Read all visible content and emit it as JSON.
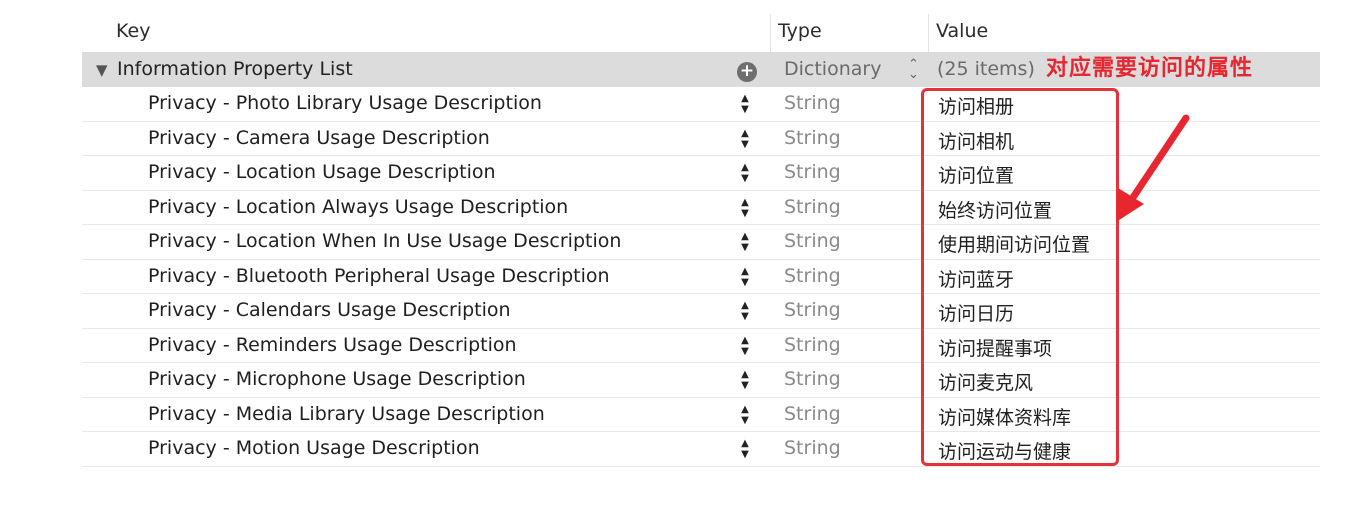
{
  "columns": {
    "key": "Key",
    "type": "Type",
    "value": "Value"
  },
  "root": {
    "key": "Information Property List",
    "type": "Dictionary",
    "value": "(25 items)"
  },
  "rows": [
    {
      "key": "Privacy - Photo Library Usage Description",
      "type": "String",
      "value": "访问相册"
    },
    {
      "key": "Privacy - Camera Usage Description",
      "type": "String",
      "value": "访问相机"
    },
    {
      "key": "Privacy - Location Usage Description",
      "type": "String",
      "value": "访问位置"
    },
    {
      "key": "Privacy - Location Always Usage Description",
      "type": "String",
      "value": "始终访问位置"
    },
    {
      "key": "Privacy - Location When In Use Usage Description",
      "type": "String",
      "value": "使用期间访问位置"
    },
    {
      "key": "Privacy - Bluetooth Peripheral Usage Description",
      "type": "String",
      "value": "访问蓝牙"
    },
    {
      "key": "Privacy - Calendars Usage Description",
      "type": "String",
      "value": "访问日历"
    },
    {
      "key": "Privacy - Reminders Usage Description",
      "type": "String",
      "value": "访问提醒事项"
    },
    {
      "key": "Privacy - Microphone Usage Description",
      "type": "String",
      "value": "访问麦克风"
    },
    {
      "key": "Privacy - Media Library Usage Description",
      "type": "String",
      "value": "访问媒体资料库"
    },
    {
      "key": "Privacy - Motion Usage Description",
      "type": "String",
      "value": "访问运动与健康"
    }
  ],
  "annotation": {
    "text": "对应需要访问的属性",
    "color": "#e8262f"
  },
  "icons": {
    "disclosure": "disclosure-triangle-icon",
    "add": "add-icon",
    "stepper": "up-down-stepper-icon"
  }
}
